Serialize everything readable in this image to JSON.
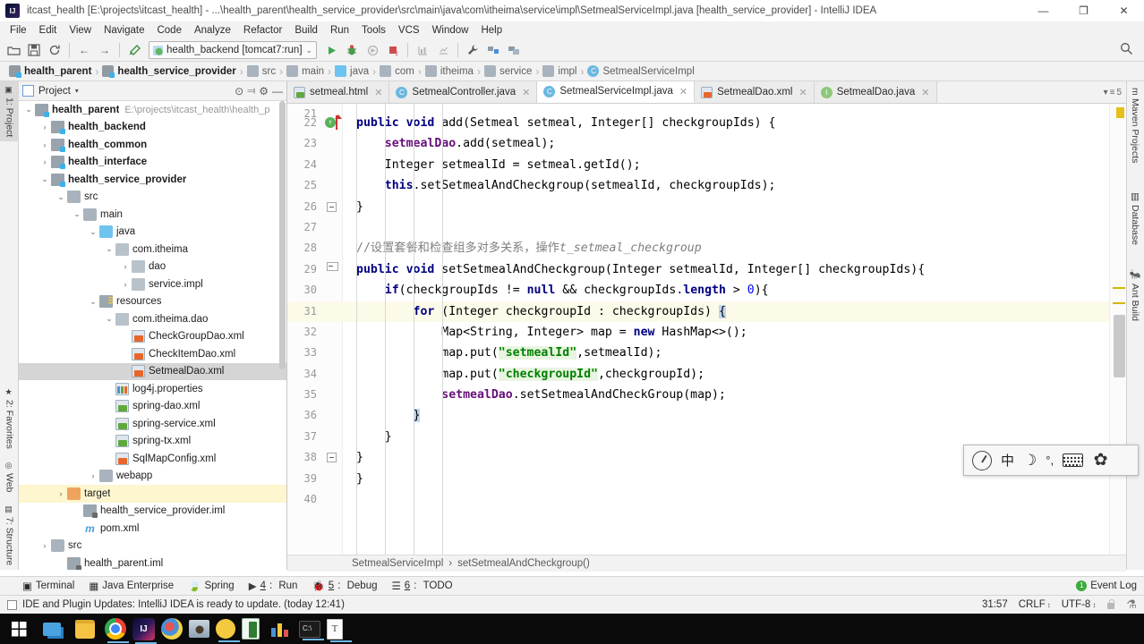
{
  "titlebar": {
    "title": "itcast_health [E:\\projects\\itcast_health] - ...\\health_parent\\health_service_provider\\src\\main\\java\\com\\itheima\\service\\impl\\SetmealServiceImpl.java [health_service_provider] - IntelliJ IDEA",
    "minimize": "—",
    "maximize": "❐",
    "close": "✕"
  },
  "menubar": {
    "items": [
      "File",
      "Edit",
      "View",
      "Navigate",
      "Code",
      "Analyze",
      "Refactor",
      "Build",
      "Run",
      "Tools",
      "VCS",
      "Window",
      "Help"
    ]
  },
  "toolbar": {
    "open_label": "open-icon",
    "save_label": "save-icon",
    "sync_label": "sync-icon",
    "back_label": "←",
    "forward_label": "→",
    "build_label": "build-hammer-icon",
    "run_config": "health_backend [tomcat7:run]",
    "run_caret": "⌄",
    "run_label": "▶",
    "debug_label": "🐞",
    "rerun_label": "↻",
    "stop_label": "■",
    "coverage_label": "coverage-icon",
    "profile_label": "profile-icon",
    "settings_label": "🔧",
    "project_structure_label": "structure-icon",
    "sdk_label": "sdk-icon",
    "search_label": "🔍"
  },
  "breadcrumb": {
    "items": [
      {
        "label": "health_parent",
        "icon": "module-icon",
        "bold": true
      },
      {
        "label": "health_service_provider",
        "icon": "module-icon",
        "bold": true
      },
      {
        "label": "src",
        "icon": "folder-icon",
        "bold": false
      },
      {
        "label": "main",
        "icon": "folder-icon",
        "bold": false
      },
      {
        "label": "java",
        "icon": "source-folder-icon",
        "bold": false
      },
      {
        "label": "com",
        "icon": "package-icon",
        "bold": false
      },
      {
        "label": "itheima",
        "icon": "package-icon",
        "bold": false
      },
      {
        "label": "service",
        "icon": "package-icon",
        "bold": false
      },
      {
        "label": "impl",
        "icon": "package-icon",
        "bold": false
      },
      {
        "label": "SetmealServiceImpl",
        "icon": "class-icon",
        "bold": false
      }
    ],
    "separator": "›"
  },
  "left_strip": {
    "project_tab": "1: Project",
    "structure_tab": "7: Structure",
    "web_tab": "Web",
    "favorites_tab": "2: Favorites"
  },
  "right_strip": {
    "maven_tab": "Maven Projects",
    "database_tab": "Database",
    "ant_tab": "Ant Build"
  },
  "project_panel": {
    "header_title": "Project",
    "header_caret": "▾",
    "collapse_icon": "⊙",
    "expand_icon": "⫤",
    "gear_icon": "⚙",
    "hide_icon": "—",
    "tree": [
      {
        "depth": 0,
        "arrow": "⌄",
        "icon": "i-module",
        "label": "health_parent",
        "path": "E:\\projects\\itcast_health\\health_p",
        "bold": true,
        "state": ""
      },
      {
        "depth": 1,
        "arrow": "›",
        "icon": "i-module",
        "label": "health_backend",
        "path": "",
        "bold": true,
        "state": ""
      },
      {
        "depth": 1,
        "arrow": "›",
        "icon": "i-module",
        "label": "health_common",
        "path": "",
        "bold": true,
        "state": ""
      },
      {
        "depth": 1,
        "arrow": "›",
        "icon": "i-module",
        "label": "health_interface",
        "path": "",
        "bold": true,
        "state": ""
      },
      {
        "depth": 1,
        "arrow": "⌄",
        "icon": "i-module",
        "label": "health_service_provider",
        "path": "",
        "bold": true,
        "state": ""
      },
      {
        "depth": 2,
        "arrow": "⌄",
        "icon": "i-folder",
        "label": "src",
        "path": "",
        "bold": false,
        "state": ""
      },
      {
        "depth": 3,
        "arrow": "⌄",
        "icon": "i-folder",
        "label": "main",
        "path": "",
        "bold": false,
        "state": ""
      },
      {
        "depth": 4,
        "arrow": "⌄",
        "icon": "i-folder blue",
        "label": "java",
        "path": "",
        "bold": false,
        "state": ""
      },
      {
        "depth": 5,
        "arrow": "⌄",
        "icon": "i-pkg",
        "label": "com.itheima",
        "path": "",
        "bold": false,
        "state": ""
      },
      {
        "depth": 6,
        "arrow": "›",
        "icon": "i-pkg",
        "label": "dao",
        "path": "",
        "bold": false,
        "state": ""
      },
      {
        "depth": 6,
        "arrow": "›",
        "icon": "i-pkg",
        "label": "service.impl",
        "path": "",
        "bold": false,
        "state": ""
      },
      {
        "depth": 4,
        "arrow": "⌄",
        "icon": "i-res",
        "label": "resources",
        "path": "",
        "bold": false,
        "state": ""
      },
      {
        "depth": 5,
        "arrow": "⌄",
        "icon": "i-pkg",
        "label": "com.itheima.dao",
        "path": "",
        "bold": false,
        "state": ""
      },
      {
        "depth": 6,
        "arrow": "",
        "icon": "i-xml",
        "label": "CheckGroupDao.xml",
        "path": "",
        "bold": false,
        "state": ""
      },
      {
        "depth": 6,
        "arrow": "",
        "icon": "i-xml",
        "label": "CheckItemDao.xml",
        "path": "",
        "bold": false,
        "state": ""
      },
      {
        "depth": 6,
        "arrow": "",
        "icon": "i-xml",
        "label": "SetmealDao.xml",
        "path": "",
        "bold": false,
        "state": "sel"
      },
      {
        "depth": 5,
        "arrow": "",
        "icon": "i-props",
        "label": "log4j.properties",
        "path": "",
        "bold": false,
        "state": ""
      },
      {
        "depth": 5,
        "arrow": "",
        "icon": "i-xml green",
        "label": "spring-dao.xml",
        "path": "",
        "bold": false,
        "state": ""
      },
      {
        "depth": 5,
        "arrow": "",
        "icon": "i-xml green",
        "label": "spring-service.xml",
        "path": "",
        "bold": false,
        "state": ""
      },
      {
        "depth": 5,
        "arrow": "",
        "icon": "i-xml green",
        "label": "spring-tx.xml",
        "path": "",
        "bold": false,
        "state": ""
      },
      {
        "depth": 5,
        "arrow": "",
        "icon": "i-xml",
        "label": "SqlMapConfig.xml",
        "path": "",
        "bold": false,
        "state": ""
      },
      {
        "depth": 4,
        "arrow": "›",
        "icon": "i-folder",
        "label": "webapp",
        "path": "",
        "bold": false,
        "state": ""
      },
      {
        "depth": 2,
        "arrow": "›",
        "icon": "i-folder orange",
        "label": "target",
        "path": "",
        "bold": false,
        "state": "hl"
      },
      {
        "depth": 3,
        "arrow": "",
        "icon": "i-iml",
        "label": "health_service_provider.iml",
        "path": "",
        "bold": false,
        "state": ""
      },
      {
        "depth": 3,
        "arrow": "",
        "icon": "i-m",
        "label": "pom.xml",
        "path": "",
        "bold": false,
        "state": ""
      },
      {
        "depth": 1,
        "arrow": "›",
        "icon": "i-folder",
        "label": "src",
        "path": "",
        "bold": false,
        "state": ""
      },
      {
        "depth": 2,
        "arrow": "",
        "icon": "i-iml",
        "label": "health_parent.iml",
        "path": "",
        "bold": false,
        "state": ""
      }
    ]
  },
  "editor": {
    "tabs": [
      {
        "label": "setmeal.html",
        "icon": "html-file-icon",
        "active": false
      },
      {
        "label": "SetmealController.java",
        "icon": "java-class-icon",
        "active": false
      },
      {
        "label": "SetmealServiceImpl.java",
        "icon": "java-class-icon",
        "active": true
      },
      {
        "label": "SetmealDao.xml",
        "icon": "xml-file-icon",
        "active": false
      },
      {
        "label": "SetmealDao.java",
        "icon": "java-interface-icon",
        "active": false
      }
    ],
    "tab_close": "✕",
    "tab_overflow": "≡",
    "tab_overflow_count": "5",
    "lines": [
      {
        "num": "21",
        "text": "",
        "partial": true
      },
      {
        "num": "22",
        "text": "public void add(Setmeal setmeal, Integer[] checkgroupIds) {"
      },
      {
        "num": "23",
        "text": "    setmealDao.add(setmeal);"
      },
      {
        "num": "24",
        "text": "    Integer setmealId = setmeal.getId();"
      },
      {
        "num": "25",
        "text": "    this.setSetmealAndCheckgroup(setmealId, checkgroupIds);"
      },
      {
        "num": "26",
        "text": "}"
      },
      {
        "num": "27",
        "text": ""
      },
      {
        "num": "28",
        "text": "//设置套餐和检查组多对多关系，操作t_setmeal_checkgroup"
      },
      {
        "num": "29",
        "text": "public void setSetmealAndCheckgroup(Integer setmealId, Integer[] checkgroupIds){"
      },
      {
        "num": "30",
        "text": "    if(checkgroupIds != null && checkgroupIds.length > 0){"
      },
      {
        "num": "31",
        "text": "        for (Integer checkgroupId : checkgroupIds) {"
      },
      {
        "num": "32",
        "text": "            Map<String, Integer> map = new HashMap<>();"
      },
      {
        "num": "33",
        "text": "            map.put(\"setmealId\",setmealId);"
      },
      {
        "num": "34",
        "text": "            map.put(\"checkgroupId\",checkgroupId);"
      },
      {
        "num": "35",
        "text": "            setmealDao.setSetmealAndCheckGroup(map);"
      },
      {
        "num": "36",
        "text": "        }"
      },
      {
        "num": "37",
        "text": "    }"
      },
      {
        "num": "38",
        "text": "}"
      },
      {
        "num": "39",
        "text": "}"
      },
      {
        "num": "40",
        "text": ""
      }
    ],
    "crumb_class": "SetmealServiceImpl",
    "crumb_method": "setSetmealAndCheckgroup()",
    "crumb_sep": "›"
  },
  "bottom_bar": {
    "items": [
      {
        "label": "Terminal",
        "icon": "terminal-icon",
        "mnemonic": ""
      },
      {
        "label": "Java Enterprise",
        "icon": "java-ee-icon",
        "mnemonic": ""
      },
      {
        "label": "Spring",
        "icon": "spring-icon",
        "mnemonic": ""
      },
      {
        "label": "Run",
        "icon": "run-icon",
        "mnemonic": "4"
      },
      {
        "label": "Debug",
        "icon": "debug-icon",
        "mnemonic": "5"
      },
      {
        "label": "TODO",
        "icon": "todo-icon",
        "mnemonic": "6"
      }
    ],
    "event_log": "Event Log",
    "event_count": "1"
  },
  "status_bar": {
    "message": "IDE and Plugin Updates: IntelliJ IDEA is ready to update. (today 12:41)",
    "caret_position": "31:57",
    "line_separator": "CRLF",
    "encoding": "UTF-8",
    "caret_glyph": "↕",
    "lock_icon": "read-only-lock-icon",
    "inspection_icon": "inspection-icon"
  },
  "ime_bar": {
    "logo": "sogou-logo-icon",
    "mode": "中",
    "moon": "☽",
    "punctuation": "°,",
    "keyboard": "keyboard-icon",
    "settings": "gear-icon"
  },
  "taskbar": {
    "items": [
      {
        "name": "start-button",
        "cls": "tk-start",
        "active": false
      },
      {
        "name": "task-view-button",
        "cls": "tk-taskview",
        "active": false
      },
      {
        "name": "file-explorer-icon",
        "cls": "tk-explorer",
        "active": true
      },
      {
        "name": "chrome-icon",
        "cls": "tk-chrome",
        "active": true
      },
      {
        "name": "intellij-idea-icon",
        "cls": "tk-idea",
        "active": true
      },
      {
        "name": "paint-icon",
        "cls": "tk-paint",
        "active": false
      },
      {
        "name": "winrar-icon",
        "cls": "tk-winrar",
        "active": false
      },
      {
        "name": "folder-icon",
        "cls": "tk-folder2",
        "active": true
      },
      {
        "name": "excel-icon",
        "cls": "tk-excel",
        "active": false
      },
      {
        "name": "charts-icon",
        "cls": "tk-charts",
        "active": false
      },
      {
        "name": "command-prompt-icon",
        "cls": "tk-cmd",
        "active": true
      },
      {
        "name": "text-document-icon",
        "cls": "tk-doc",
        "active": true
      }
    ]
  },
  "colors": {
    "accent_blue": "#4a90d9",
    "keyword": "#000080",
    "string": "#008000",
    "field": "#660e7a",
    "comment": "#808080",
    "highlight_row": "#fcfae8",
    "selection": "#d5d5d5",
    "warning": "#e6c019"
  }
}
